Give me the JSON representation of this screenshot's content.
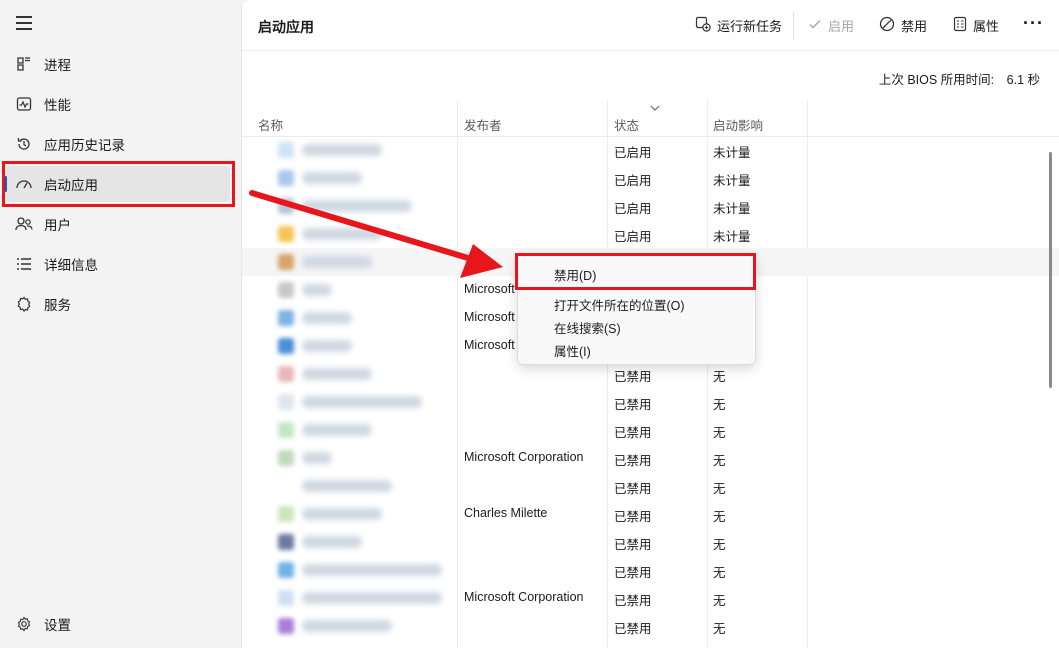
{
  "sidebar": {
    "items": [
      {
        "label": "进程",
        "icon": "processes-icon"
      },
      {
        "label": "性能",
        "icon": "performance-icon"
      },
      {
        "label": "应用历史记录",
        "icon": "history-icon"
      },
      {
        "label": "启动应用",
        "icon": "startup-apps-icon"
      },
      {
        "label": "用户",
        "icon": "users-icon"
      },
      {
        "label": "详细信息",
        "icon": "details-icon"
      },
      {
        "label": "服务",
        "icon": "services-icon"
      }
    ],
    "settings_label": "设置",
    "active_index": 3
  },
  "toolbar": {
    "title": "启动应用",
    "run_new_task": "运行新任务",
    "enable": "启用",
    "disable": "禁用",
    "properties": "属性",
    "more": "···"
  },
  "bios_time": "上次 BIOS 所用时间:　6.1 秒",
  "columns": {
    "name": "名称",
    "publisher": "发布者",
    "status": "状态",
    "impact": "启动影响"
  },
  "rows": [
    {
      "publisher": "",
      "status": "已启用",
      "impact": "未计量",
      "icon_color": "#cfe3f7",
      "name_w": 80
    },
    {
      "publisher": "",
      "status": "已启用",
      "impact": "未计量",
      "icon_color": "#a9c8ef",
      "name_w": 60
    },
    {
      "publisher": "",
      "status": "已启用",
      "impact": "未计量",
      "icon_color": "#b8c5d6",
      "name_w": 110
    },
    {
      "publisher": "",
      "status": "已启用",
      "impact": "未计量",
      "icon_color": "#f6c451",
      "name_w": 80
    },
    {
      "publisher": "",
      "status": "",
      "impact": "",
      "icon_color": "#d9a36b",
      "name_w": 70
    },
    {
      "publisher": "Microsoft",
      "status": "",
      "impact": "",
      "icon_color": "#c8c8c8",
      "name_w": 30
    },
    {
      "publisher": "Microsoft",
      "status": "",
      "impact": "",
      "icon_color": "#7fb2e5",
      "name_w": 50
    },
    {
      "publisher": "Microsoft",
      "status": "",
      "impact": "",
      "icon_color": "#4a90d9",
      "name_w": 50
    },
    {
      "publisher": "",
      "status": "已禁用",
      "impact": "无",
      "icon_color": "#e8b7b7",
      "name_w": 70
    },
    {
      "publisher": "",
      "status": "已禁用",
      "impact": "无",
      "icon_color": "#dfe6ee",
      "name_w": 120
    },
    {
      "publisher": "",
      "status": "已禁用",
      "impact": "无",
      "icon_color": "#c4e6c4",
      "name_w": 70
    },
    {
      "publisher": "Microsoft Corporation",
      "status": "已禁用",
      "impact": "无",
      "icon_color": "#c2d9bf",
      "name_w": 30
    },
    {
      "publisher": "",
      "status": "已禁用",
      "impact": "无",
      "icon_color": "#ffffff",
      "name_w": 90
    },
    {
      "publisher": "Charles Milette",
      "status": "已禁用",
      "impact": "无",
      "icon_color": "#cde6b8",
      "name_w": 80
    },
    {
      "publisher": "",
      "status": "已禁用",
      "impact": "无",
      "icon_color": "#6b7aa3",
      "name_w": 60
    },
    {
      "publisher": "",
      "status": "已禁用",
      "impact": "无",
      "icon_color": "#6fb3e8",
      "name_w": 140
    },
    {
      "publisher": "Microsoft Corporation",
      "status": "已禁用",
      "impact": "无",
      "icon_color": "#cfe0f5",
      "name_w": 140
    },
    {
      "publisher": "",
      "status": "已禁用",
      "impact": "无",
      "icon_color": "#a780d9",
      "name_w": 90
    }
  ],
  "context_menu": {
    "disable": "禁用(D)",
    "open_location": "打开文件所在的位置(O)",
    "search_online": "在线搜索(S)",
    "properties": "属性(I)"
  },
  "annotation_color": "#e6161a"
}
